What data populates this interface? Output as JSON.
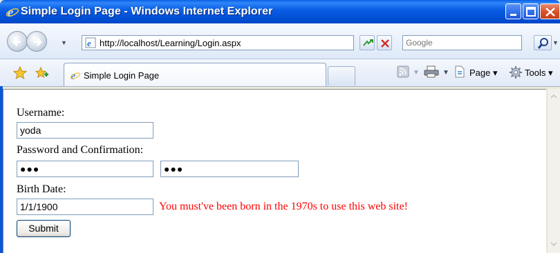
{
  "window": {
    "title": "Simple Login Page - Windows Internet Explorer"
  },
  "address_bar": {
    "url": "http://localhost/Learning/Login.aspx"
  },
  "search": {
    "placeholder": "Google"
  },
  "tabs": [
    {
      "label": "Simple Login Page"
    }
  ],
  "command_bar": {
    "page_label": "Page",
    "tools_label": "Tools"
  },
  "form": {
    "username_label": "Username:",
    "username_value": "yoda",
    "password_label": "Password and Confirmation:",
    "password_mask": "●●●",
    "confirm_mask": "●●●",
    "birthdate_label": "Birth Date:",
    "birthdate_value": "1/1/1900",
    "error_message": "You must've been born in the 1970s to use this web site!",
    "submit_label": "Submit"
  },
  "colors": {
    "error": "#FF0000",
    "titlebar": "#0A5FE6"
  },
  "icons": [
    "ie-icon",
    "minimize-icon",
    "maximize-icon",
    "close-icon",
    "back-icon",
    "forward-icon",
    "refresh-icon",
    "stop-icon",
    "search-icon",
    "favorites-star-icon",
    "add-favorite-icon",
    "feeds-icon",
    "print-icon",
    "page-icon",
    "tools-icon"
  ]
}
